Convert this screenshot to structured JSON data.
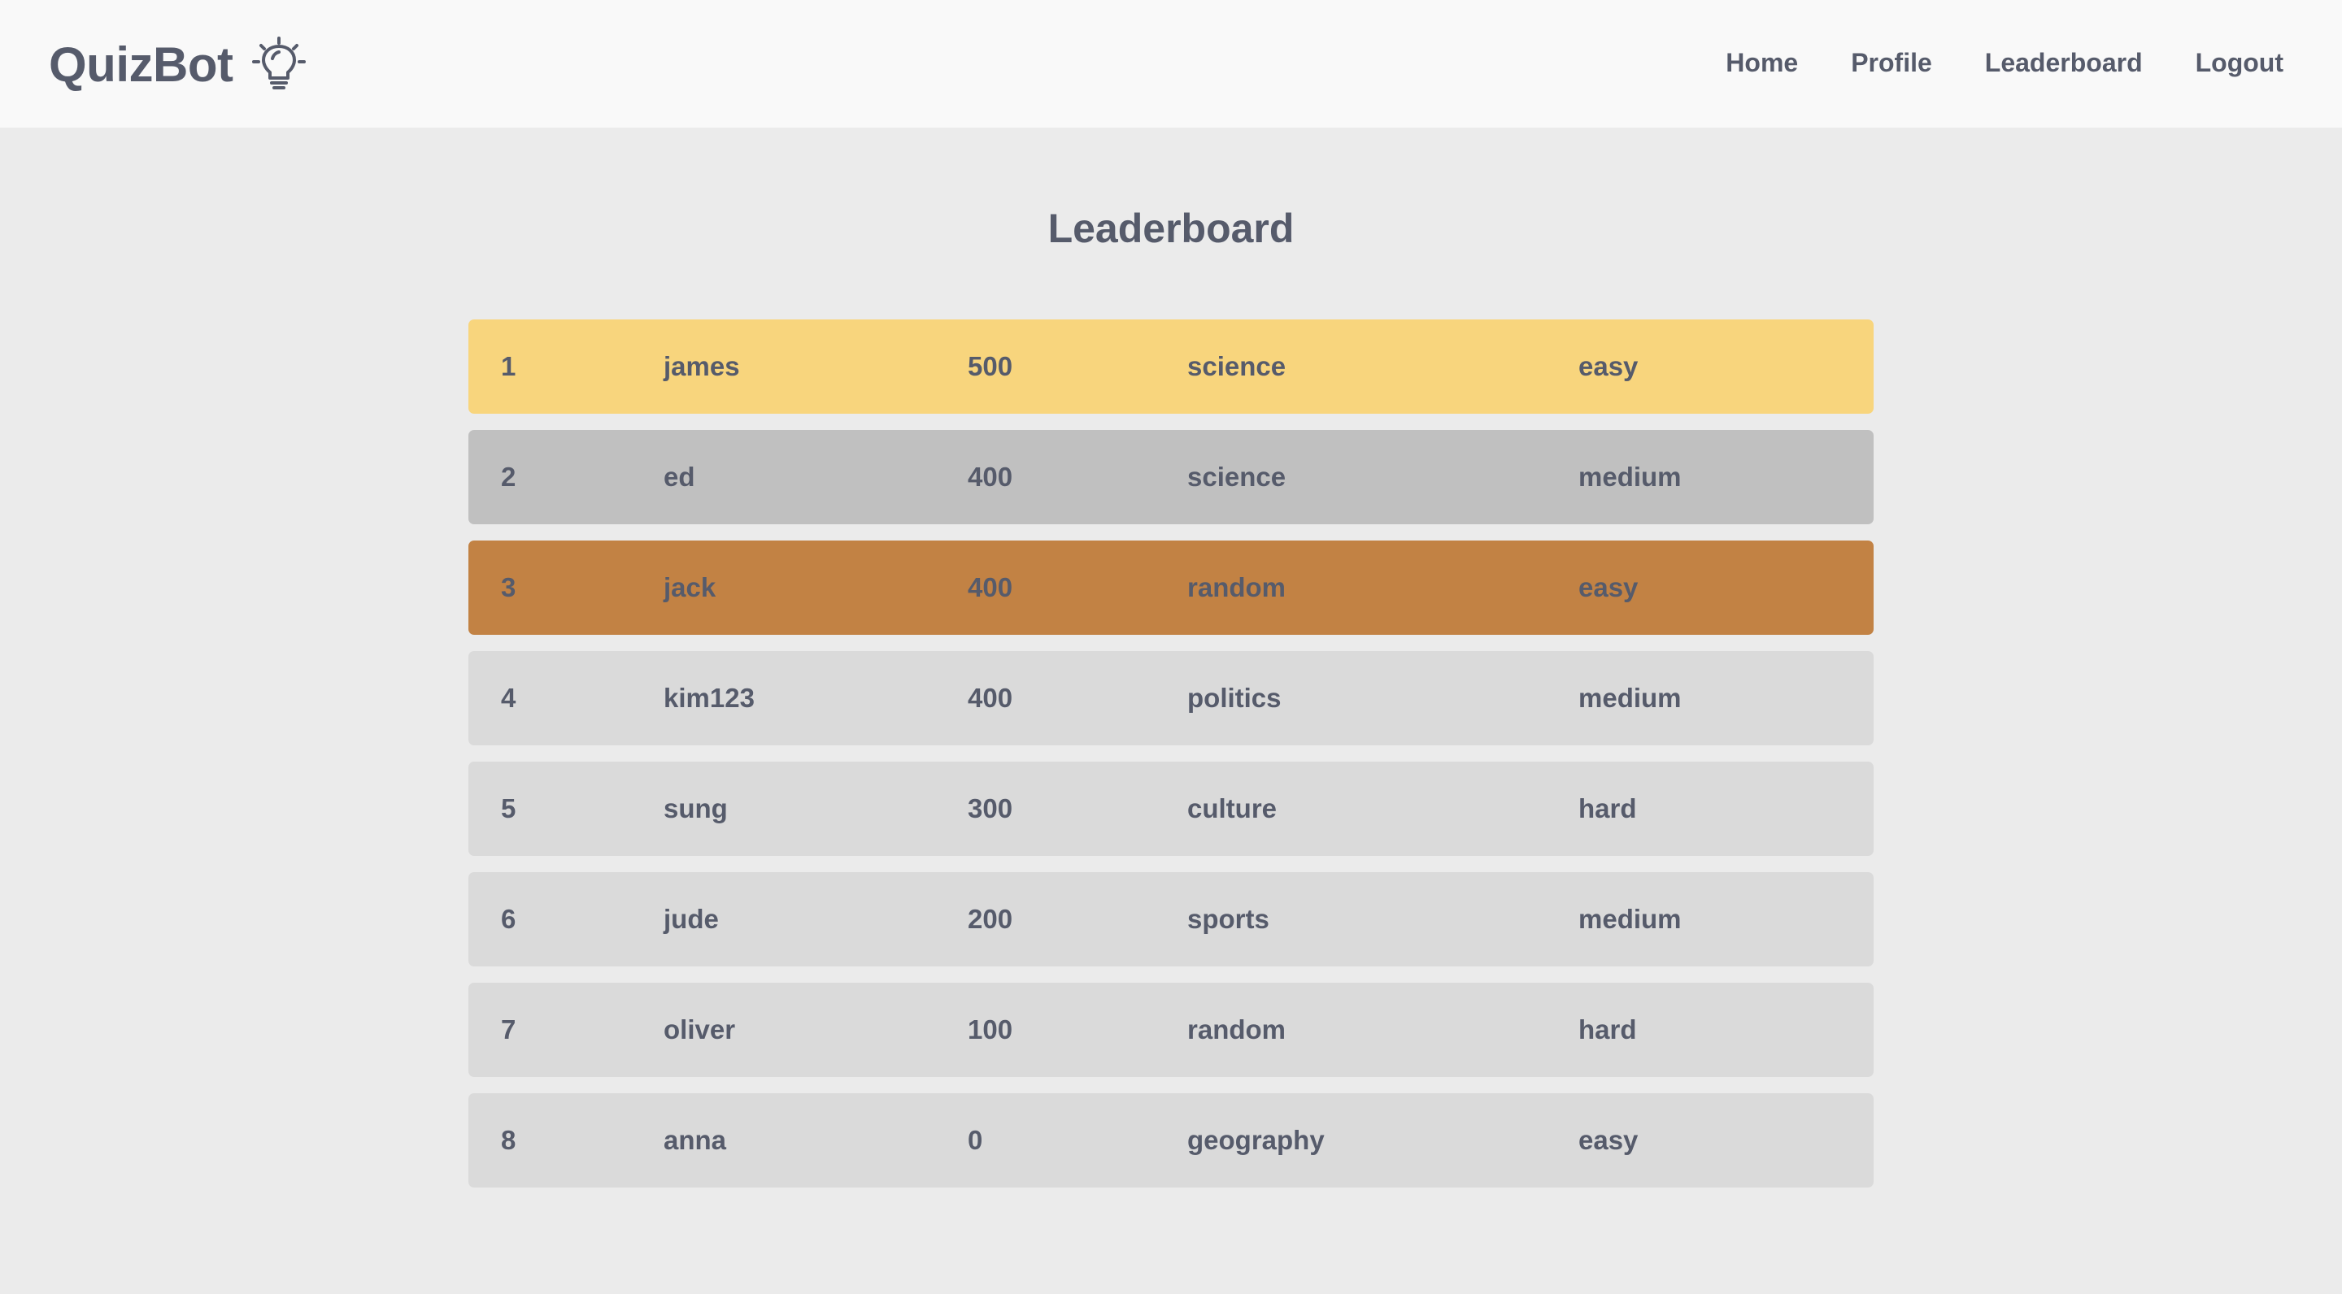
{
  "brand": {
    "name": "QuizBot",
    "icon": "lightbulb-icon"
  },
  "nav": {
    "items": [
      {
        "label": "Home"
      },
      {
        "label": "Profile"
      },
      {
        "label": "Leaderboard"
      },
      {
        "label": "Logout"
      }
    ]
  },
  "page": {
    "title": "Leaderboard"
  },
  "colors": {
    "gold": "#f8d57d",
    "silver": "#c0c0c0",
    "bronze": "#c28244",
    "default_row": "#dadada",
    "text": "#565b6b"
  },
  "leaderboard": {
    "rows": [
      {
        "rank": "1",
        "user": "james",
        "score": "500",
        "category": "science",
        "difficulty": "easy"
      },
      {
        "rank": "2",
        "user": "ed",
        "score": "400",
        "category": "science",
        "difficulty": "medium"
      },
      {
        "rank": "3",
        "user": "jack",
        "score": "400",
        "category": "random",
        "difficulty": "easy"
      },
      {
        "rank": "4",
        "user": "kim123",
        "score": "400",
        "category": "politics",
        "difficulty": "medium"
      },
      {
        "rank": "5",
        "user": "sung",
        "score": "300",
        "category": "culture",
        "difficulty": "hard"
      },
      {
        "rank": "6",
        "user": "jude",
        "score": "200",
        "category": "sports",
        "difficulty": "medium"
      },
      {
        "rank": "7",
        "user": "oliver",
        "score": "100",
        "category": "random",
        "difficulty": "hard"
      },
      {
        "rank": "8",
        "user": "anna",
        "score": "0",
        "category": "geography",
        "difficulty": "easy"
      }
    ]
  }
}
